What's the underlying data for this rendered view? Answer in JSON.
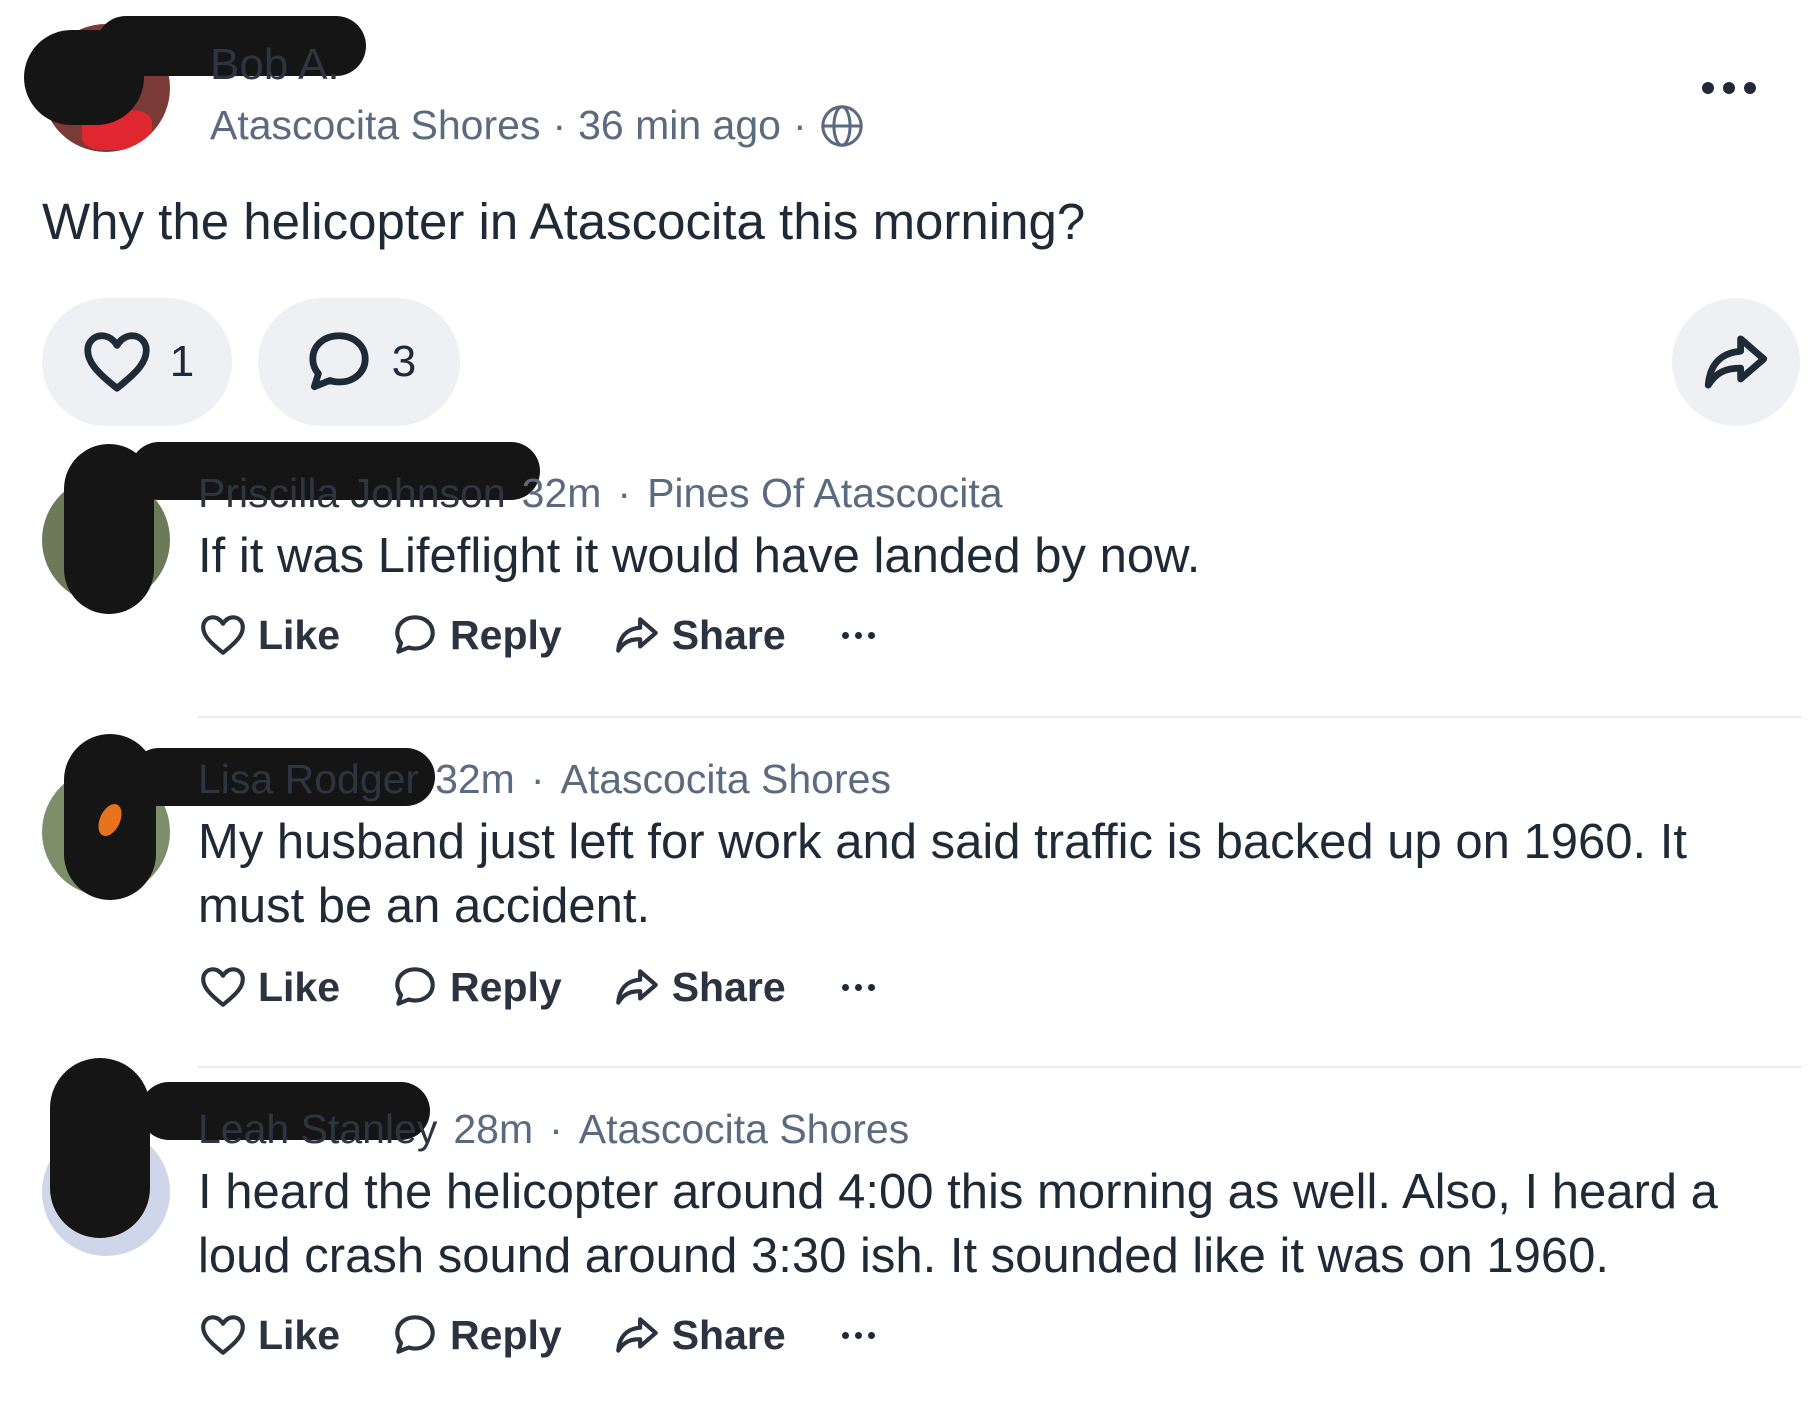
{
  "post": {
    "author": "Bob A.",
    "neighborhood": "Atascocita Shores",
    "time": "36 min ago",
    "separator": "·",
    "body": "Why the helicopter in Atascocita this morning?",
    "like_count": "1",
    "comment_count": "3",
    "icons": {
      "visibility": "globe-icon",
      "menu": "more-options-icon",
      "like": "heart-icon",
      "comment": "speech-bubble-icon",
      "share": "share-arrow-icon"
    }
  },
  "comments": [
    {
      "author": "Priscilla Johnson",
      "time": "32m",
      "neighborhood": "Pines Of Atascocita",
      "text": "If it was Lifeflight it would have landed by now."
    },
    {
      "author": "Lisa Rodger",
      "time": "32m",
      "neighborhood": "Atascocita Shores",
      "text": "My husband just left for work and said traffic is backed up on 1960. It must be an accident."
    },
    {
      "author": "Leah Stanley",
      "time": "28m",
      "neighborhood": "Atascocita Shores",
      "text": "I heard the helicopter around 4:00 this morning as well.  Also, I heard a loud crash sound around 3:30 ish.  It sounded like it was on 1960."
    }
  ],
  "actions": {
    "like_label": "Like",
    "reply_label": "Reply",
    "share_label": "Share"
  },
  "colors": {
    "text": "#1f2a37",
    "meta": "#5b6b7f",
    "pill_bg": "#eef0f4",
    "divider": "#e6e8ec"
  }
}
